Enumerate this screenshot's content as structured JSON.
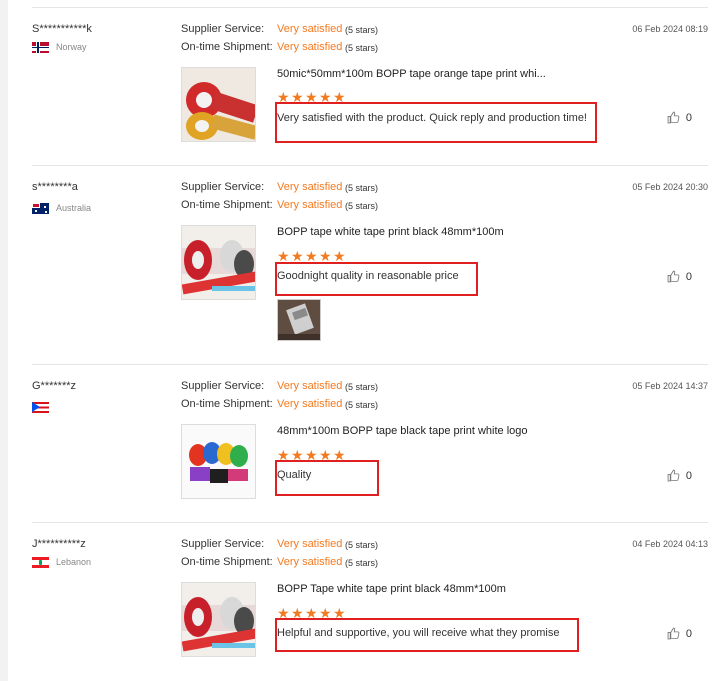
{
  "labels": {
    "supplier_service": "Supplier Service:",
    "on_time_shipment": "On-time Shipment:"
  },
  "reviews": [
    {
      "user": "S***********k",
      "country": "Norway",
      "flag": "norway-flag",
      "supplier_value": "Very satisfied",
      "supplier_stars": "(5 stars)",
      "shipment_value": "Very satisfied",
      "shipment_stars": "(5 stars)",
      "date": "06 Feb 2024 08:19",
      "product": "50mic*50mm*100m BOPP tape orange tape print whi...",
      "rating": 5,
      "comment": "Very satisfied with the product. Quick reply and production time!",
      "likes": "0"
    },
    {
      "user": "s********a",
      "country": "Australia",
      "flag": "australia-flag",
      "supplier_value": "Very satisfied",
      "supplier_stars": "(5 stars)",
      "shipment_value": "Very satisfied",
      "shipment_stars": "(5 stars)",
      "date": "05 Feb 2024 20:30",
      "product": "BOPP tape white tape print black 48mm*100m",
      "rating": 5,
      "comment": "Goodnight quality in reasonable price",
      "likes": "0"
    },
    {
      "user": "G*******z",
      "country": "",
      "flag": "puerto-rico-flag",
      "supplier_value": "Very satisfied",
      "supplier_stars": "(5 stars)",
      "shipment_value": "Very satisfied",
      "shipment_stars": "(5 stars)",
      "date": "05 Feb 2024 14:37",
      "product": "48mm*100m BOPP tape black tape print white logo",
      "rating": 5,
      "comment": "Quality",
      "likes": "0"
    },
    {
      "user": "J**********z",
      "country": "Lebanon",
      "flag": "lebanon-flag",
      "supplier_value": "Very satisfied",
      "supplier_stars": "(5 stars)",
      "shipment_value": "Very satisfied",
      "shipment_stars": "(5 stars)",
      "date": "04 Feb 2024 04:13",
      "product": "BOPP Tape white tape print black 48mm*100m",
      "rating": 5,
      "comment": "Helpful and supportive,  you will receive what they promise",
      "likes": "0"
    }
  ],
  "colors": {
    "accent": "#f47a20",
    "highlight_box": "#e02020"
  }
}
